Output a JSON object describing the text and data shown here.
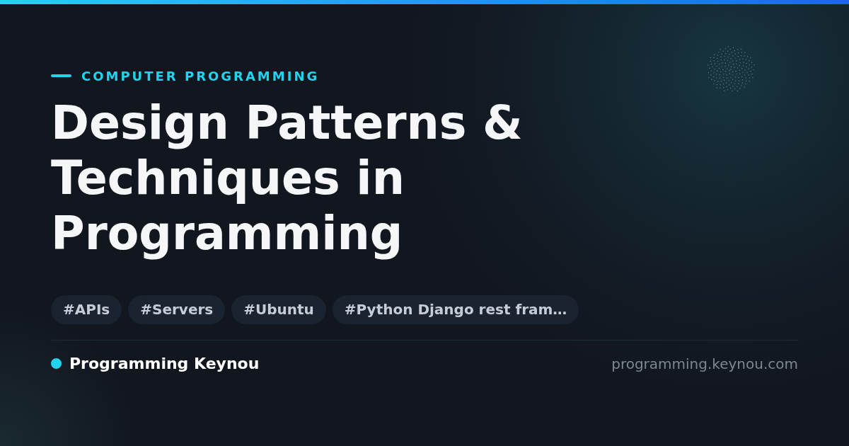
{
  "category": "COMPUTER PROGRAMMING",
  "title": "Design Patterns & Techniques in Programming",
  "tags": [
    "#APIs",
    "#Servers",
    "#Ubuntu",
    "#Python Django rest fram…"
  ],
  "footer": {
    "site_name": "Programming Keynou",
    "url": "programming.keynou.com"
  }
}
